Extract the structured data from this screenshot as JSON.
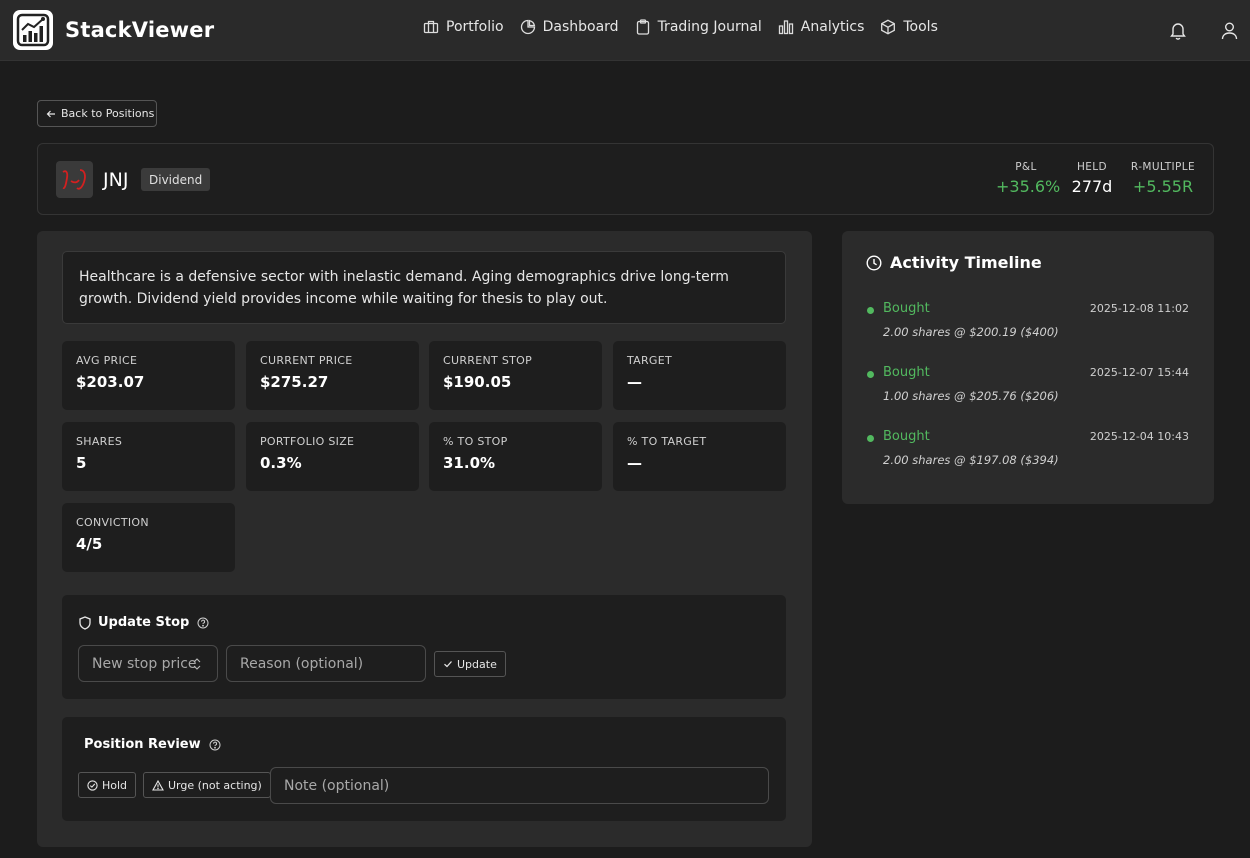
{
  "app": {
    "name": "StackViewer"
  },
  "nav": {
    "items": [
      {
        "label": "Portfolio",
        "icon": "briefcase-icon"
      },
      {
        "label": "Dashboard",
        "icon": "pie-chart-icon"
      },
      {
        "label": "Trading Journal",
        "icon": "clipboard-icon"
      },
      {
        "label": "Analytics",
        "icon": "bar-chart-icon"
      },
      {
        "label": "Tools",
        "icon": "box-icon"
      }
    ]
  },
  "back_button": {
    "label": "Back to Positions"
  },
  "position": {
    "ticker": "JNJ",
    "tag": "Dividend",
    "stats": [
      {
        "label": "P&L",
        "value": "+35.6%"
      },
      {
        "label": "HELD",
        "value": "277d"
      },
      {
        "label": "R-MULTIPLE",
        "value": "+5.55R"
      }
    ],
    "thesis": "Healthcare is a defensive sector with inelastic demand. Aging demographics drive long-term growth. Dividend yield provides income while waiting for thesis to play out."
  },
  "metrics": [
    {
      "label": "AVG PRICE",
      "value": "$203.07"
    },
    {
      "label": "CURRENT PRICE",
      "value": "$275.27"
    },
    {
      "label": "CURRENT STOP",
      "value": "$190.05"
    },
    {
      "label": "TARGET",
      "value": "—"
    },
    {
      "label": "SHARES",
      "value": "5"
    },
    {
      "label": "PORTFOLIO SIZE",
      "value": "0.3%"
    },
    {
      "label": "% TO STOP",
      "value": "31.0%"
    },
    {
      "label": "% TO TARGET",
      "value": "—"
    },
    {
      "label": "CONVICTION",
      "value": "4/5"
    }
  ],
  "update_stop": {
    "title": "Update Stop",
    "price_placeholder": "New stop price",
    "reason_placeholder": "Reason (optional)",
    "button_label": "Update"
  },
  "review": {
    "title": "Position Review",
    "hold_label": "Hold",
    "urge_label": "Urge (not acting)",
    "note_placeholder": "Note (optional)"
  },
  "timeline": {
    "title": "Activity Timeline",
    "events": [
      {
        "type": "Bought",
        "time": "2025-12-08 11:02",
        "detail": "2.00 shares @ $200.19 ($400)"
      },
      {
        "type": "Bought",
        "time": "2025-12-07 15:44",
        "detail": "1.00 shares @ $205.76 ($206)"
      },
      {
        "type": "Bought",
        "time": "2025-12-04 10:43",
        "detail": "2.00 shares @ $197.08 ($394)"
      }
    ]
  },
  "colors": {
    "positive": "#52b95f",
    "background": "#1c1c1c",
    "panel": "#2b2b2b"
  }
}
